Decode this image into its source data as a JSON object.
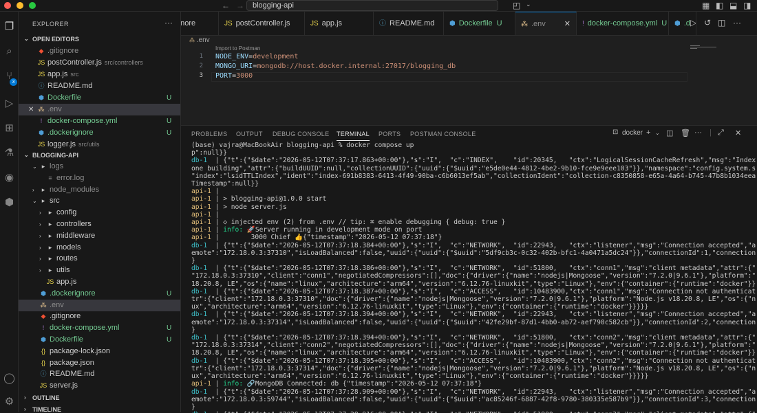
{
  "titlebar": {
    "search_text": "blogging-api"
  },
  "sidebar": {
    "title": "EXPLORER",
    "open_editors_label": "OPEN EDITORS",
    "open_editors": [
      {
        "icon": "git-icon",
        "name": ".gitignore",
        "desc": "",
        "status": "",
        "color": "c-dim",
        "closable": false
      },
      {
        "icon": "js-icon",
        "name": "postController.js",
        "desc": "src/controllers",
        "status": "",
        "color": "c-white",
        "closable": false
      },
      {
        "icon": "js-icon",
        "name": "app.js",
        "desc": "src",
        "status": "",
        "color": "c-white",
        "closable": false
      },
      {
        "icon": "info-icon",
        "name": "README.md",
        "desc": "",
        "status": "",
        "color": "c-white",
        "closable": false
      },
      {
        "icon": "docker-icon",
        "name": "Dockerfile",
        "desc": "",
        "status": "U",
        "color": "c-green",
        "closable": false
      },
      {
        "icon": "env-icon",
        "name": ".env",
        "desc": "",
        "status": "",
        "color": "c-dim",
        "closable": true
      },
      {
        "icon": "yaml-icon",
        "name": "docker-compose.yml",
        "desc": "",
        "status": "U",
        "color": "c-green",
        "closable": false
      },
      {
        "icon": "docker-icon",
        "name": ".dockerignore",
        "desc": "",
        "status": "U",
        "color": "c-green",
        "closable": false
      },
      {
        "icon": "js-icon",
        "name": "logger.js",
        "desc": "src/utils",
        "status": "",
        "color": "c-white",
        "closable": false
      }
    ],
    "project_label": "BLOGGING-API",
    "tree": [
      {
        "depth": 1,
        "twisty": "v",
        "icon": "folder-icon",
        "name": "logs",
        "status": "",
        "color": "c-dim"
      },
      {
        "depth": 2,
        "twisty": "",
        "icon": "log-icon",
        "name": "error.log",
        "status": "",
        "color": "c-dim"
      },
      {
        "depth": 1,
        "twisty": ">",
        "icon": "folder-icon",
        "name": "node_modules",
        "status": "",
        "color": "c-dim"
      },
      {
        "depth": 1,
        "twisty": "v",
        "icon": "folder-icon",
        "name": "src",
        "status": "",
        "color": "c-white"
      },
      {
        "depth": 2,
        "twisty": ">",
        "icon": "folder-icon",
        "name": "config",
        "status": "",
        "color": "c-white"
      },
      {
        "depth": 2,
        "twisty": ">",
        "icon": "folder-icon",
        "name": "controllers",
        "status": "",
        "color": "c-white"
      },
      {
        "depth": 2,
        "twisty": ">",
        "icon": "folder-icon",
        "name": "middleware",
        "status": "",
        "color": "c-white"
      },
      {
        "depth": 2,
        "twisty": ">",
        "icon": "folder-icon",
        "name": "models",
        "status": "",
        "color": "c-white"
      },
      {
        "depth": 2,
        "twisty": ">",
        "icon": "folder-icon",
        "name": "routes",
        "status": "",
        "color": "c-white"
      },
      {
        "depth": 2,
        "twisty": ">",
        "icon": "folder-icon",
        "name": "utils",
        "status": "",
        "color": "c-white"
      },
      {
        "depth": 2,
        "twisty": "",
        "icon": "js-icon",
        "name": "app.js",
        "status": "",
        "color": "c-white"
      },
      {
        "depth": 1,
        "twisty": "",
        "icon": "docker-icon",
        "name": ".dockerignore",
        "status": "U",
        "color": "c-green"
      },
      {
        "depth": 1,
        "twisty": "",
        "icon": "env-icon",
        "name": ".env",
        "status": "",
        "color": "c-dim"
      },
      {
        "depth": 1,
        "twisty": "",
        "icon": "git-icon",
        "name": ".gitignore",
        "status": "",
        "color": "c-white"
      },
      {
        "depth": 1,
        "twisty": "",
        "icon": "yaml-icon",
        "name": "docker-compose.yml",
        "status": "U",
        "color": "c-green"
      },
      {
        "depth": 1,
        "twisty": "",
        "icon": "docker-icon",
        "name": "Dockerfile",
        "status": "U",
        "color": "c-green"
      },
      {
        "depth": 1,
        "twisty": "",
        "icon": "json-icon",
        "name": "package-lock.json",
        "status": "",
        "color": "c-white"
      },
      {
        "depth": 1,
        "twisty": "",
        "icon": "json-icon",
        "name": "package.json",
        "status": "",
        "color": "c-white"
      },
      {
        "depth": 1,
        "twisty": "",
        "icon": "info-icon",
        "name": "README.md",
        "status": "",
        "color": "c-white"
      },
      {
        "depth": 1,
        "twisty": "",
        "icon": "js-icon",
        "name": "server.js",
        "status": "",
        "color": "c-white"
      }
    ],
    "outline_label": "OUTLINE",
    "timeline_label": "TIMELINE"
  },
  "activity": {
    "scm_badge": "3"
  },
  "tabs": [
    {
      "icon": "",
      "name": "gnore",
      "status": "",
      "color": "c-white",
      "active": false
    },
    {
      "icon": "js-icon",
      "name": "postController.js",
      "status": "",
      "color": "c-white",
      "active": false
    },
    {
      "icon": "js-icon",
      "name": "app.js",
      "status": "",
      "color": "c-white",
      "active": false
    },
    {
      "icon": "info-icon",
      "name": "README.md",
      "status": "",
      "color": "c-white",
      "active": false
    },
    {
      "icon": "docker-icon",
      "name": "Dockerfile",
      "status": "U",
      "color": "c-green",
      "active": false
    },
    {
      "icon": "env-icon",
      "name": ".env",
      "status": "",
      "color": "c-dim",
      "active": true
    },
    {
      "icon": "yaml-icon",
      "name": "docker-compose.yml",
      "status": "U",
      "color": "c-green",
      "active": false
    },
    {
      "icon": "docker-icon",
      "name": ".d",
      "status": "",
      "color": "c-green",
      "active": false
    }
  ],
  "editor": {
    "breadcrumb": ".env",
    "codelens": "Import to Postman",
    "lines": [
      {
        "num": "1",
        "key": "NODE_ENV",
        "value": "development"
      },
      {
        "num": "2",
        "key": "MONGO_URI",
        "value": "mongodb://host.docker.internal:27017/blogging_db"
      },
      {
        "num": "3",
        "key": "PORT",
        "value": "3000"
      }
    ]
  },
  "panel": {
    "tabs": [
      "PROBLEMS",
      "OUTPUT",
      "DEBUG CONSOLE",
      "TERMINAL",
      "PORTS",
      "POSTMAN CONSOLE"
    ],
    "active_tab": "TERMINAL",
    "terminal_name": "docker",
    "lines": [
      {
        "prefix": "",
        "text": "(base) vajra@MacBookAir blogging-api % docker compose up"
      },
      {
        "prefix": "",
        "text": "p\":null}}"
      },
      {
        "prefix": "db-1",
        "text": "  | {\"t\":{\"$date\":\"2026-05-12T07:37:17.863+00:00\"},\"s\":\"I\",  \"c\":\"INDEX\",    \"id\":20345,   \"ctx\":\"LogicalSessionCacheRefresh\",\"msg\":\"Index build: d"
      },
      {
        "prefix": "",
        "text": "one building\",\"attr\":{\"buildUUID\":null,\"collectionUUID\":{\"uuid\":{\"$uuid\":\"e5de0e44-4812-4be2-9b10-fce9e9eee103\"}},\"namespace\":\"config.system.sessions\","
      },
      {
        "prefix": "",
        "text": "\"index\":\"lsidTTLIndex\",\"ident\":\"index-691b8383-6413-4f49-90ba-c6b6013ef5ab\",\"collectionIdent\":\"collection-c8350858-e65a-4a64-b745-47b8b1034eea\",\"commit"
      },
      {
        "prefix": "",
        "text": "Timestamp\":null}}"
      },
      {
        "prefix": "api-1",
        "text": " |"
      },
      {
        "prefix": "api-1",
        "text": " | > blogging-api@1.0.0 start"
      },
      {
        "prefix": "api-1",
        "text": " | > node server.js"
      },
      {
        "prefix": "api-1",
        "text": " |"
      },
      {
        "prefix": "api-1",
        "text": " | ◇ injected env (2) from .env // tip: ⌘ enable debugging { debug: true }"
      },
      {
        "prefix": "api-1",
        "text": " | info: 🚀Server running in development mode on port",
        "info": true
      },
      {
        "prefix": "api-1",
        "text": " |        3000 Chief 👍{\"timestamp\":\"2026-05-12 07:37:18\"}"
      },
      {
        "prefix": "db-1",
        "text": "  | {\"t\":{\"$date\":\"2026-05-12T07:37:18.384+00:00\"},\"s\":\"I\",  \"c\":\"NETWORK\",  \"id\":22943,   \"ctx\":\"listener\",\"msg\":\"Connection accepted\",\"attr\":{\"r"
      },
      {
        "prefix": "",
        "text": "emote\":\"172.18.0.3:37310\",\"isLoadBalanced\":false,\"uuid\":{\"uuid\":{\"$uuid\":\"5df9cb3c-0c32-402b-bfc1-4a0471a5dc24\"}},\"connectionId\":1,\"connectionCount\":1}"
      },
      {
        "prefix": "",
        "text": "}"
      },
      {
        "prefix": "db-1",
        "text": "  | {\"t\":{\"$date\":\"2026-05-12T07:37:18.386+00:00\"},\"s\":\"I\",  \"c\":\"NETWORK\",  \"id\":51800,   \"ctx\":\"conn1\",\"msg\":\"client metadata\",\"attr\":{\"remote\":"
      },
      {
        "prefix": "",
        "text": "\"172.18.0.3:37310\",\"client\":\"conn1\",\"negotiatedCompressors\":[],\"doc\":{\"driver\":{\"name\":\"nodejs|Mongoose\",\"version\":\"7.2.0|9.6.1\"},\"platform\":\"Node.js v"
      },
      {
        "prefix": "",
        "text": "18.20.8, LE\",\"os\":{\"name\":\"linux\",\"architecture\":\"arm64\",\"version\":\"6.12.76-linuxkit\",\"type\":\"Linux\"},\"env\":{\"container\":{\"runtime\":\"docker\"}}}}}"
      },
      {
        "prefix": "db-1",
        "text": "  | {\"t\":{\"$date\":\"2026-05-12T07:37:18.387+00:00\"},\"s\":\"I\",  \"c\":\"ACCESS\",   \"id\":10483900,\"ctx\":\"conn1\",\"msg\":\"Connection not authenticating\",\"at"
      },
      {
        "prefix": "",
        "text": "tr\":{\"client\":\"172.18.0.3:37310\",\"doc\":{\"driver\":{\"name\":\"nodejs|Mongoose\",\"version\":\"7.2.0|9.6.1\"},\"platform\":\"Node.js v18.20.8, LE\",\"os\":{\"name\":\"lin"
      },
      {
        "prefix": "",
        "text": "ux\",\"architecture\":\"arm64\",\"version\":\"6.12.76-linuxkit\",\"type\":\"Linux\"},\"env\":{\"container\":{\"runtime\":\"docker\"}}}}}"
      },
      {
        "prefix": "db-1",
        "text": "  | {\"t\":{\"$date\":\"2026-05-12T07:37:18.394+00:00\"},\"s\":\"I\",  \"c\":\"NETWORK\",  \"id\":22943,   \"ctx\":\"listener\",\"msg\":\"Connection accepted\",\"attr\":{\"r"
      },
      {
        "prefix": "",
        "text": "emote\":\"172.18.0.3:37314\",\"isLoadBalanced\":false,\"uuid\":{\"uuid\":{\"$uuid\":\"42fe29bf-87d1-4bb0-ab72-aef790c582cb\"}},\"connectionId\":2,\"connectionCount\":2}"
      },
      {
        "prefix": "",
        "text": "}"
      },
      {
        "prefix": "db-1",
        "text": "  | {\"t\":{\"$date\":\"2026-05-12T07:37:18.394+00:00\"},\"s\":\"I\",  \"c\":\"NETWORK\",  \"id\":51800,   \"ctx\":\"conn2\",\"msg\":\"client metadata\",\"attr\":{\"remote\":"
      },
      {
        "prefix": "",
        "text": "\"172.18.0.3:37314\",\"client\":\"conn2\",\"negotiatedCompressors\":[],\"doc\":{\"driver\":{\"name\":\"nodejs|Mongoose\",\"version\":\"7.2.0|9.6.1\"},\"platform\":\"Node.js v"
      },
      {
        "prefix": "",
        "text": "18.20.8, LE\",\"os\":{\"name\":\"linux\",\"architecture\":\"arm64\",\"version\":\"6.12.76-linuxkit\",\"type\":\"Linux\"},\"env\":{\"container\":{\"runtime\":\"docker\"}}}}}"
      },
      {
        "prefix": "db-1",
        "text": "  | {\"t\":{\"$date\":\"2026-05-12T07:37:18.395+00:00\"},\"s\":\"I\",  \"c\":\"ACCESS\",   \"id\":10483900,\"ctx\":\"conn2\",\"msg\":\"Connection not authenticating\",\"at"
      },
      {
        "prefix": "",
        "text": "tr\":{\"client\":\"172.18.0.3:37314\",\"doc\":{\"driver\":{\"name\":\"nodejs|Mongoose\",\"version\":\"7.2.0|9.6.1\"},\"platform\":\"Node.js v18.20.8, LE\",\"os\":{\"name\":\"lin"
      },
      {
        "prefix": "",
        "text": "ux\",\"architecture\":\"arm64\",\"version\":\"6.12.76-linuxkit\",\"type\":\"Linux\"},\"env\":{\"container\":{\"runtime\":\"docker\"}}}}}"
      },
      {
        "prefix": "api-1",
        "text": " | info: 🔗MongoDB Connected: db {\"timestamp\":\"2026-05-12 07:37:18\"}",
        "info": true
      },
      {
        "prefix": "db-1",
        "text": "  | {\"t\":{\"$date\":\"2026-05-12T07:37:28.909+00:00\"},\"s\":\"I\",  \"c\":\"NETWORK\",  \"id\":22943,   \"ctx\":\"listener\",\"msg\":\"Connection accepted\",\"attr\":{\"r"
      },
      {
        "prefix": "",
        "text": "emote\":\"172.18.0.3:59744\",\"isLoadBalanced\":false,\"uuid\":{\"uuid\":{\"$uuid\":\"ac85246f-6887-42f8-9780-380335e587b9\"}},\"connectionId\":3,\"connectionCount\":3}"
      },
      {
        "prefix": "",
        "text": "}"
      },
      {
        "prefix": "db-1",
        "text": "  | {\"t\":{\"$date\":\"2026-05-12T07:37:28.916+00:00\"},\"s\":\"I\",  \"c\":\"NETWORK\",  \"id\":51800,   \"ctx\":\"conn3\",\"msg\":\"client metadata\",\"attr\":{\"remote\":"
      },
      {
        "prefix": "",
        "text": "\"172.18.0.3:59744\",\"client\":\"conn3\",\"negotiatedCompressors\":[],\"doc\":{\"driver\":{\"name\":\"nodejs|Mongoose\",\"version\":\"7.2.0|9.6.1\"},\"platform\":\"Node.js v"
      }
    ]
  }
}
